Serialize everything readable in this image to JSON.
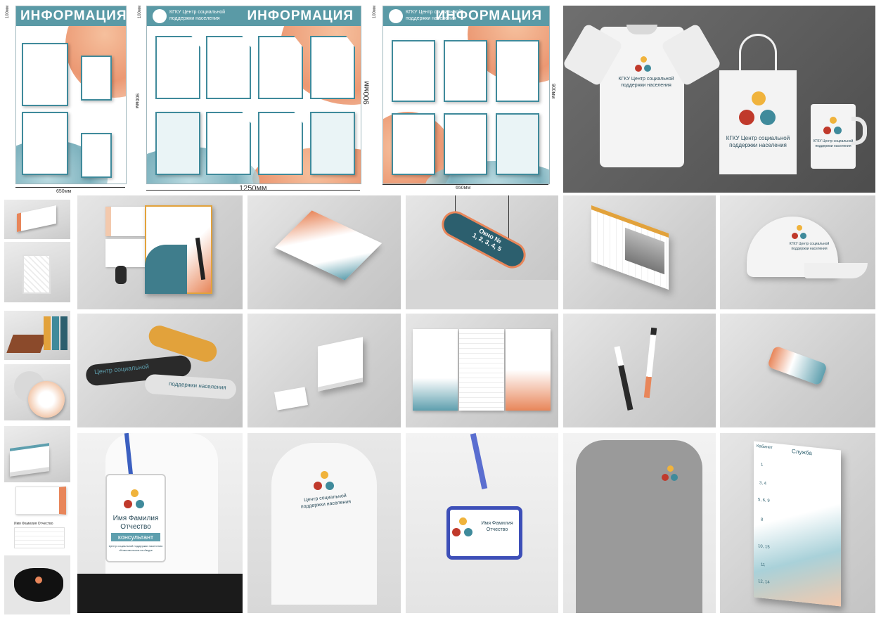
{
  "boards": {
    "board1": {
      "title": "ИНФОРМАЦИЯ",
      "dim_w": "650мм",
      "dim_h": "900мм",
      "dim_top": "100мм"
    },
    "board2": {
      "org_line1": "КГКУ Центр социальной",
      "org_line2": "поддержки населения",
      "title": "ИНФОРМАЦИЯ",
      "dim_w": "1250мм",
      "dim_h": "900мм",
      "dim_top": "100мм"
    },
    "board3": {
      "org_line1": "КГКУ Центр социальной",
      "org_line2": "поддержки населения",
      "title": "ИНФОРМАЦИЯ",
      "dim_w": "650мм",
      "dim_h": "900мм",
      "dim_top": "100мм"
    }
  },
  "merch": {
    "tshirt_line1": "КГКУ Центр социальной",
    "tshirt_line2": "поддержки населения",
    "bag_line1": "КГКУ Центр социальной",
    "bag_line2": "поддержки населения",
    "mug_line1": "КГКУ Центр социальной",
    "mug_line2": "поддержки населения",
    "cap_line1": "КГКУ Центр социальной",
    "cap_line2": "поддержки населения",
    "sign_line1": "Окно №",
    "sign_line2": "1, 2, 3, 4, 5",
    "band_text1": "Центр социальной",
    "band_text2": "поддержки населения"
  },
  "people": {
    "badge_name1": "Имя Фамилия",
    "badge_name2": "Отчество",
    "badge_role": "консультант",
    "badge_org": "Центр социальной поддержки населения г.Комсомольска-на-Амуре",
    "tee_line1": "Центр социальной",
    "tee_line2": "поддержки населения",
    "badge2_name1": "Имя Фамилия",
    "badge2_name2": "Отчество",
    "bizcard_name": "Имя Фамилия Отчество"
  },
  "directory": {
    "head_col1": "Кабинет",
    "head_col2": "Служба",
    "rows": [
      "1",
      "3, 4",
      "5, 6, 9",
      "8",
      "10, 15",
      "11",
      "12, 14"
    ]
  },
  "colors": {
    "teal": "#3f8a9b",
    "orange": "#e8865a",
    "dark_blue": "#2c5f6e",
    "red": "#c0392b",
    "yellow": "#f0b33c"
  }
}
